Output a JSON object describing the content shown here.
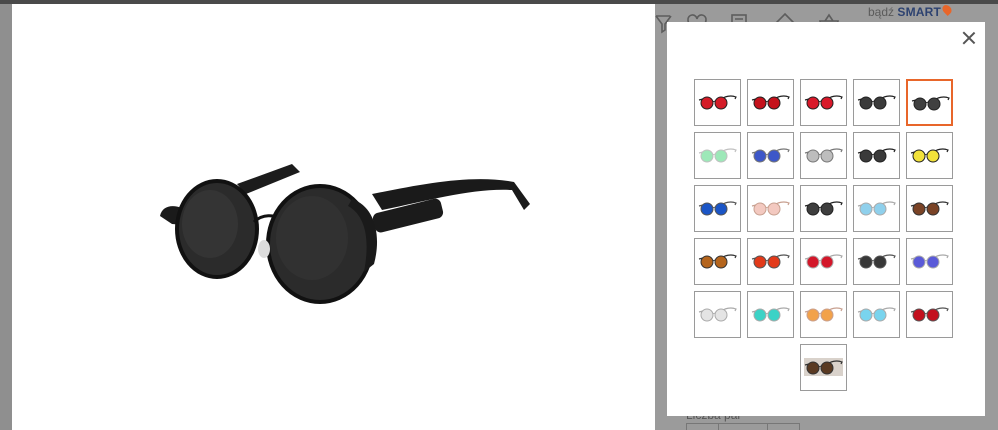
{
  "header": {
    "smart_prefix": "bądź",
    "smart_brand": "SMART",
    "icons": [
      "filter-icon",
      "heart-icon",
      "calculator-icon",
      "user-icon",
      "basket-icon"
    ]
  },
  "below": {
    "quantity_label": "Liczba par"
  },
  "gallery": {
    "selected_index": 4,
    "thumbnails": [
      {
        "lens": "#d41c28",
        "frame": "#222"
      },
      {
        "lens": "#c4121c",
        "frame": "#222"
      },
      {
        "lens": "#d9192a",
        "frame": "#222"
      },
      {
        "lens": "#3b3b3b",
        "frame": "#222"
      },
      {
        "lens": "#404040",
        "frame": "#222"
      },
      {
        "lens": "#9de8b8",
        "frame": "#c0c0c0"
      },
      {
        "lens": "#3d57c8",
        "frame": "#777"
      },
      {
        "lens": "#bdbdbd",
        "frame": "#777"
      },
      {
        "lens": "#3a3a3a",
        "frame": "#222"
      },
      {
        "lens": "#f2e23a",
        "frame": "#222"
      },
      {
        "lens": "#1b55c6",
        "frame": "#555"
      },
      {
        "lens": "#f3c9c0",
        "frame": "#c8a090"
      },
      {
        "lens": "#3e3e3e",
        "frame": "#222"
      },
      {
        "lens": "#8fd0ec",
        "frame": "#aaa"
      },
      {
        "lens": "#7a4326",
        "frame": "#333"
      },
      {
        "lens": "#b5651d",
        "frame": "#333"
      },
      {
        "lens": "#e23a1a",
        "frame": "#555"
      },
      {
        "lens": "#d3172a",
        "frame": "#aaa"
      },
      {
        "lens": "#383838",
        "frame": "#555"
      },
      {
        "lens": "#5a5ad8",
        "frame": "#aaa"
      },
      {
        "lens": "#e4e4e4",
        "frame": "#aaa"
      },
      {
        "lens": "#3cd2c6",
        "frame": "#aaa"
      },
      {
        "lens": "#f2a24a",
        "frame": "#c8a090"
      },
      {
        "lens": "#79d4ee",
        "frame": "#aaa"
      },
      {
        "lens": "#c3101e",
        "frame": "#555"
      },
      {
        "lens": "#5a3a22",
        "frame": "#333",
        "photo": true
      }
    ]
  }
}
